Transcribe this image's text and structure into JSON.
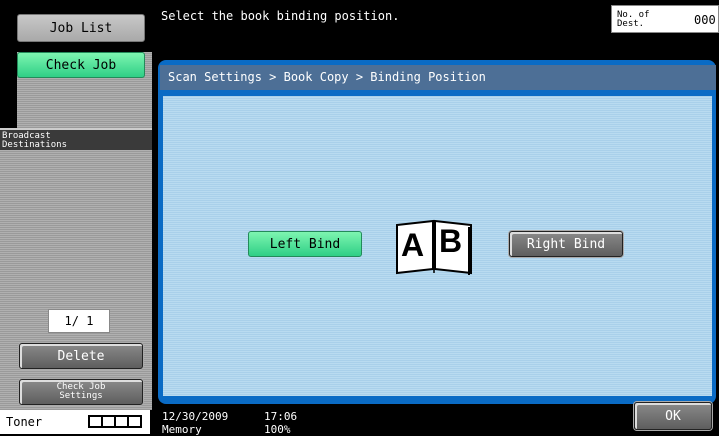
{
  "left": {
    "job_list_label": "Job List",
    "check_job_label": "Check Job",
    "broadcast_title_1": "Broadcast",
    "broadcast_title_2": "Destinations",
    "page_counter": "1/ 1",
    "delete_label": "Delete",
    "check_job_settings_1": "Check Job",
    "check_job_settings_2": "Settings",
    "toner_label": "Toner"
  },
  "header": {
    "message": "Select the book binding position.",
    "dest_label_1": "No. of",
    "dest_label_2": "Dest.",
    "dest_value": "000"
  },
  "breadcrumb": "Scan Settings > Book Copy > Binding Position",
  "binding": {
    "left_bind_label": "Left Bind",
    "right_bind_label": "Right Bind",
    "book_left_letter": "A",
    "book_right_letter": "B",
    "selected": "Left Bind"
  },
  "status": {
    "date": "12/30/2009",
    "time": "17:06",
    "memory_label": "Memory",
    "memory_value": "100%"
  },
  "ok_label": "OK"
}
